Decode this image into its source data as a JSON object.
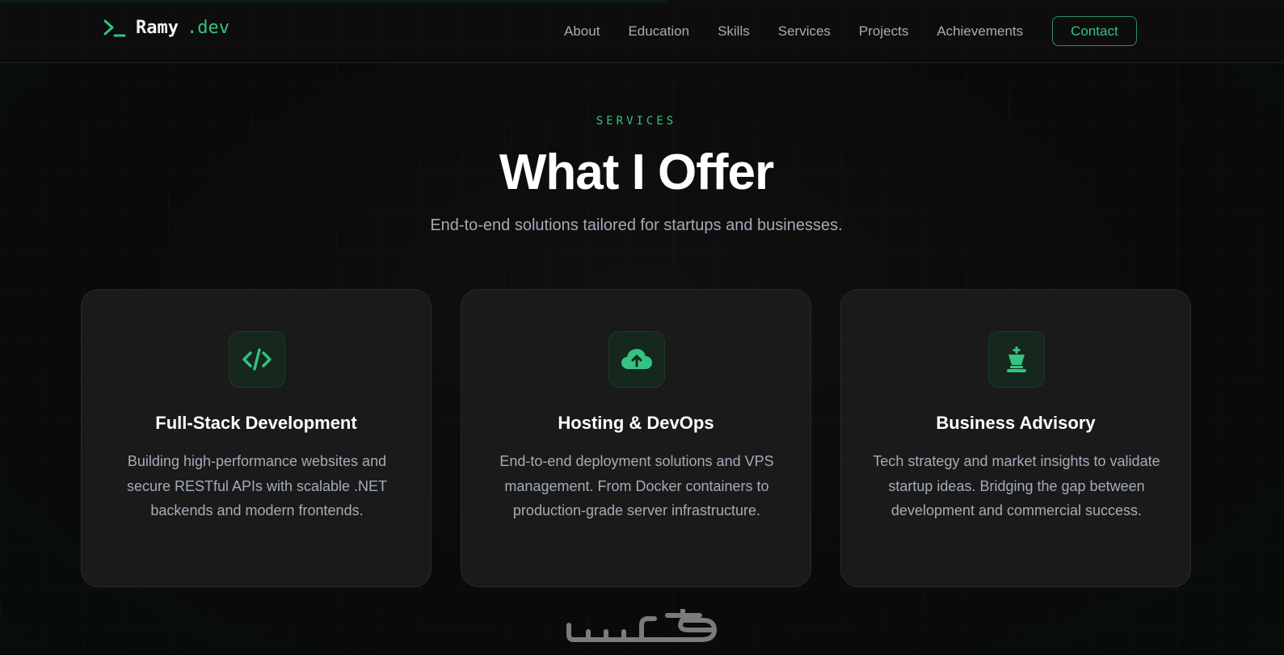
{
  "header": {
    "logo": {
      "name": "Ramy",
      "tld": ".dev"
    },
    "nav": [
      "About",
      "Education",
      "Skills",
      "Services",
      "Projects",
      "Achievements"
    ],
    "contact_label": "Contact",
    "scroll_progress": 0.52
  },
  "hero": {
    "eyebrow": "SERVICES",
    "title": "What I Offer",
    "subtitle": "End-to-end solutions tailored for startups and businesses."
  },
  "cards": [
    {
      "icon": "code-icon",
      "title": "Full-Stack Development",
      "description": "Building high-performance websites and secure RESTful APIs with scalable .NET backends and modern frontends."
    },
    {
      "icon": "cloud-upload-icon",
      "title": "Hosting & DevOps",
      "description": "End-to-end deployment solutions and VPS management. From Docker containers to production-grade server infrastructure."
    },
    {
      "icon": "chess-king-icon",
      "title": "Business Advisory",
      "description": "Tech strategy and market insights to validate startup ideas. Bridging the gap between development and commercial success."
    }
  ],
  "watermark": {
    "text": "خمسات"
  },
  "colors": {
    "accent": "#34c381",
    "background": "#0b0b0b",
    "card": "#1a1a1a",
    "muted_text": "#a3acb9"
  }
}
